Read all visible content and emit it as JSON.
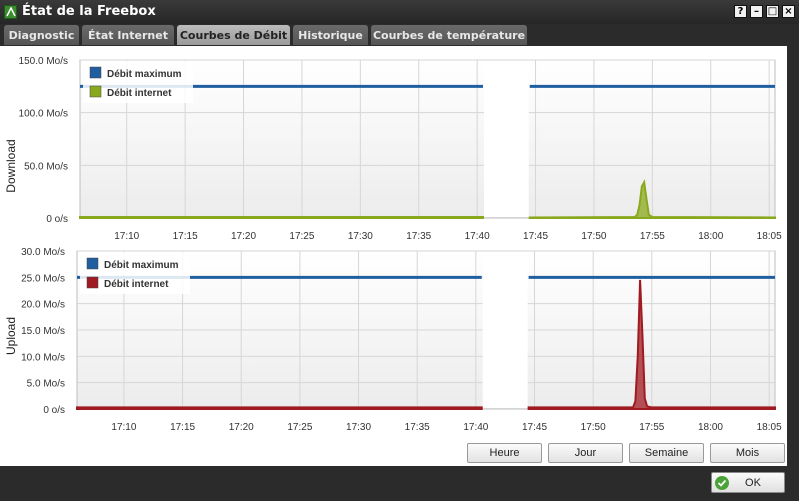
{
  "window": {
    "title": "État de la Freebox",
    "buttons": [
      "?",
      "–",
      "□",
      "×"
    ]
  },
  "tabs": [
    {
      "label": "Diagnostic",
      "active": false
    },
    {
      "label": "État Internet",
      "active": false
    },
    {
      "label": "Courbes de Débit",
      "active": true
    },
    {
      "label": "Historique",
      "active": false
    },
    {
      "label": "Courbes de température",
      "active": false
    }
  ],
  "range_buttons": [
    "Heure",
    "Jour",
    "Semaine",
    "Mois"
  ],
  "footer": {
    "ok_label": "OK"
  },
  "colors": {
    "max_line": "#1f5fa0",
    "download_fill": "#8aa81c",
    "upload_fill": "#a01a22"
  },
  "chart_data": [
    {
      "type": "area",
      "ylabel": "Download",
      "y_ticks": [
        "150.0 Mo/s",
        "100.0 Mo/s",
        "50.0 Mo/s",
        "0 o/s"
      ],
      "y_tick_values": [
        150,
        100,
        50,
        0
      ],
      "ylim": [
        0,
        150
      ],
      "x_ticks": [
        "17:10",
        "17:15",
        "17:20",
        "17:25",
        "17:30",
        "17:35",
        "17:40",
        "17:45",
        "17:50",
        "17:55",
        "18:00",
        "18:05"
      ],
      "xlim": [
        "17:06",
        "18:05.5"
      ],
      "gap": [
        "17:40.5",
        "17:44.5"
      ],
      "grid": true,
      "legend": "top-left",
      "series": [
        {
          "name": "Débit maximum",
          "x": [
            "17:06",
            "17:40.5",
            "17:44.5",
            "18:05.5"
          ],
          "y": [
            125,
            125,
            125,
            125
          ]
        },
        {
          "name": "Débit internet",
          "x": [
            "17:06",
            "17:40.5",
            "17:44.5",
            "17:53.5",
            "17:53.7",
            "17:53.9",
            "17:54.1",
            "17:54.3",
            "17:54.5",
            "17:54.7",
            "17:55",
            "18:05.5"
          ],
          "y": [
            1,
            1,
            0.5,
            1,
            3,
            12,
            30,
            34,
            18,
            3,
            1,
            0.5
          ]
        }
      ]
    },
    {
      "type": "area",
      "ylabel": "Upload",
      "y_ticks": [
        "30.0 Mo/s",
        "25.0 Mo/s",
        "20.0 Mo/s",
        "15.0 Mo/s",
        "10.0 Mo/s",
        "5.0 Mo/s",
        "0 o/s"
      ],
      "y_tick_values": [
        30,
        25,
        20,
        15,
        10,
        5,
        0
      ],
      "ylim": [
        0,
        30
      ],
      "x_ticks": [
        "17:10",
        "17:15",
        "17:20",
        "17:25",
        "17:30",
        "17:35",
        "17:40",
        "17:45",
        "17:50",
        "17:55",
        "18:00",
        "18:05"
      ],
      "xlim": [
        "17:06",
        "18:05.5"
      ],
      "gap": [
        "17:40.5",
        "17:44.5"
      ],
      "grid": true,
      "legend": "top-left",
      "series": [
        {
          "name": "Débit maximum",
          "x": [
            "17:06",
            "17:40.5",
            "17:44.5",
            "18:05.5"
          ],
          "y": [
            25,
            25,
            25,
            25
          ]
        },
        {
          "name": "Débit internet",
          "x": [
            "17:06",
            "17:40.5",
            "17:44.5",
            "17:53.4",
            "17:53.6",
            "17:53.8",
            "17:54.0",
            "17:54.2",
            "17:54.4",
            "17:54.6",
            "17:55",
            "18:05.5"
          ],
          "y": [
            0.3,
            0.3,
            0.3,
            0.3,
            1.5,
            10,
            24.5,
            14,
            2,
            0.5,
            0.3,
            0.3
          ]
        }
      ]
    }
  ]
}
